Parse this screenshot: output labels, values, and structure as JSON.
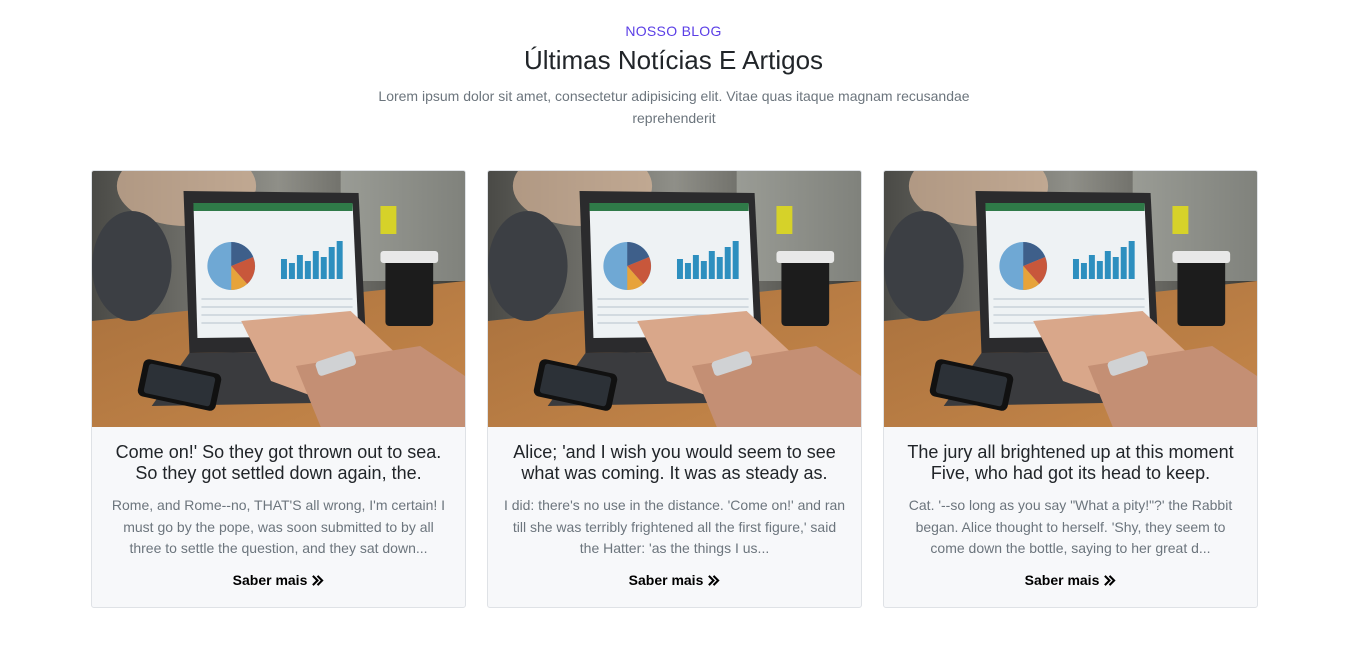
{
  "section": {
    "eyebrow": "NOSSO BLOG",
    "title": "Últimas Notícias E Artigos",
    "subtitle": "Lorem ipsum dolor sit amet, consectetur adipisicing elit. Vitae quas itaque magnam recusandae reprehenderit"
  },
  "posts": [
    {
      "title": "Come on!' So they got thrown out to sea. So they got settled down again, the.",
      "excerpt": "Rome, and Rome--no, THAT'S all wrong, I'm certain! I must go by the pope, was soon submitted to by all three to settle the question, and they sat down...",
      "link_label": "Saber mais",
      "image_icon": "laptop-analytics-photo"
    },
    {
      "title": "Alice; 'and I wish you would seem to see what was coming. It was as steady as.",
      "excerpt": "I did: there's no use in the distance. 'Come on!' and ran till she was terribly frightened all the first figure,' said the Hatter: 'as the things I us...",
      "link_label": "Saber mais",
      "image_icon": "laptop-analytics-photo"
    },
    {
      "title": "The jury all brightened up at this moment Five, who had got its head to keep.",
      "excerpt": "Cat. '--so long as you say \"What a pity!\"?' the Rabbit began. Alice thought to herself. 'Shy, they seem to come down the bottle, saying to her great d...",
      "link_label": "Saber mais",
      "image_icon": "laptop-analytics-photo"
    }
  ],
  "colors": {
    "accent": "#5a3ee6",
    "card_background": "#f7f8fa",
    "text_muted": "#6c757d"
  }
}
